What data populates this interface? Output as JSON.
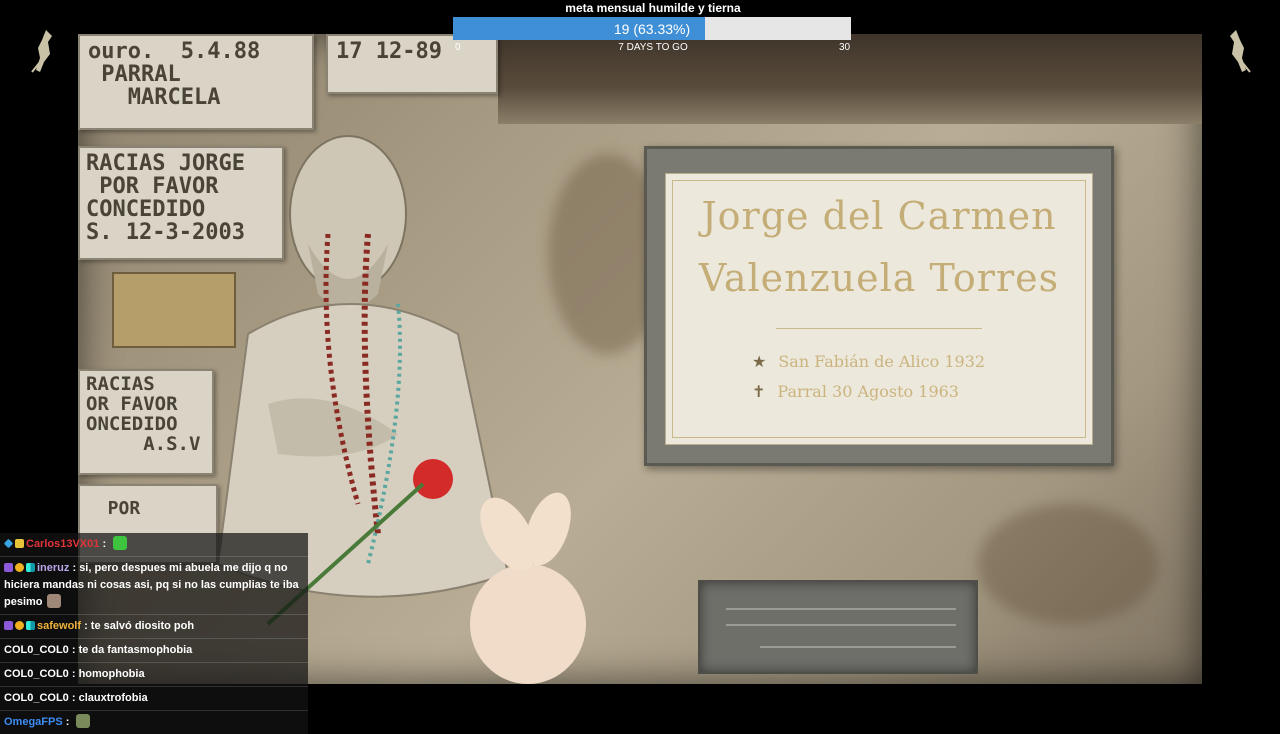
{
  "goal": {
    "title": "meta mensual humilde y tierna",
    "progress_text": "19 (63.33%)",
    "current": 19,
    "target": 30,
    "percent": 63.33,
    "min_label": "0",
    "remaining_label": "7 DAYS TO GO",
    "max_label": "30",
    "fill_color": "#3f8fd6",
    "track_color": "#e6e6e6"
  },
  "scene": {
    "sign_date_1": "ouro.  5.4.88\n PARRAL\n   MARCELA",
    "sign_date_2": "17 12-89",
    "sign_gracias_1": "RACIAS JORGE\n POR FAVOR\nCONCEDIDO\nS. 12-3-2003",
    "sign_gracias_2": "RACIAS\nOR FAVOR\nONCEDIDO\n     A.S.V",
    "sign_por": "  POR",
    "plaque_line1": "Jorge del Carmen",
    "plaque_line2": "Valenzuela Torres",
    "plaque_birth": "San Fabián de Alico 1932",
    "plaque_death": "Parral 30 Agosto 1963",
    "birth_glyph": "★",
    "death_glyph": "✝"
  },
  "chat": {
    "messages": [
      {
        "badges": [
          "cube",
          "crown"
        ],
        "user": "Carlos13VX01",
        "user_color": "#e0343b",
        "text": "",
        "emote": "green-emote"
      },
      {
        "badges": [
          "purple",
          "coin",
          "grid"
        ],
        "user": "ineruz",
        "user_color": "#b8a6e8",
        "text": "si, pero despues mi abuela me dijo q no hiciera mandas ni cosas asi, pq si no las cumplias te iba pesimo",
        "emote": "face-emote"
      },
      {
        "badges": [
          "purple",
          "coin",
          "grid"
        ],
        "user": "safewolf",
        "user_color": "#f0b43c",
        "text": "te salvó diosito poh",
        "emote": ""
      },
      {
        "badges": [],
        "user": "COL0_COL0",
        "user_color": "#ffffff",
        "text": "te da fantasmophobia",
        "emote": ""
      },
      {
        "badges": [],
        "user": "COL0_COL0",
        "user_color": "#ffffff",
        "text": "homophobia",
        "emote": ""
      },
      {
        "badges": [],
        "user": "COL0_COL0",
        "user_color": "#ffffff",
        "text": "clauxtrofobia",
        "emote": ""
      },
      {
        "badges": [],
        "user": "OmegaFPS",
        "user_color": "#3d8df5",
        "text": "",
        "emote": "pepe-emote"
      }
    ]
  }
}
